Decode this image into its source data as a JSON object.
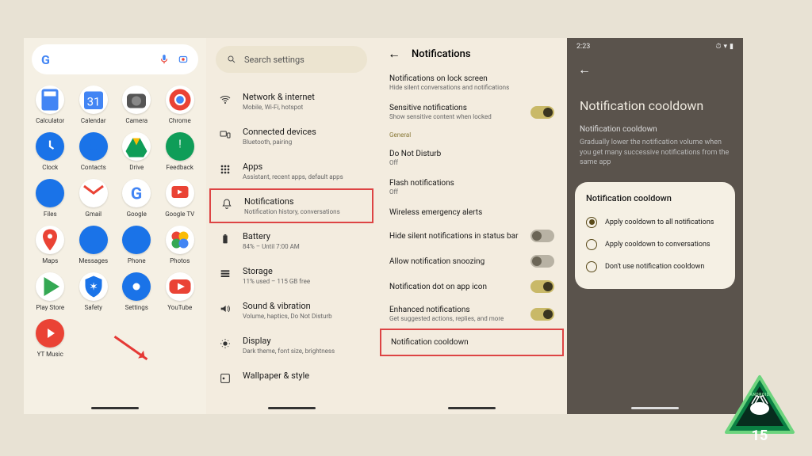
{
  "panel1": {
    "apps": [
      {
        "label": "Calculator",
        "icon": "calc"
      },
      {
        "label": "Calendar",
        "icon": "cal"
      },
      {
        "label": "Camera",
        "icon": "cam"
      },
      {
        "label": "Chrome",
        "icon": "chrome"
      },
      {
        "label": "Clock",
        "icon": "clock"
      },
      {
        "label": "Contacts",
        "icon": "contacts"
      },
      {
        "label": "Drive",
        "icon": "drive"
      },
      {
        "label": "Feedback",
        "icon": "feedback"
      },
      {
        "label": "Files",
        "icon": "files"
      },
      {
        "label": "Gmail",
        "icon": "gmail"
      },
      {
        "label": "Google",
        "icon": "google"
      },
      {
        "label": "Google TV",
        "icon": "gtv"
      },
      {
        "label": "Maps",
        "icon": "maps"
      },
      {
        "label": "Messages",
        "icon": "messages"
      },
      {
        "label": "Phone",
        "icon": "phone"
      },
      {
        "label": "Photos",
        "icon": "photos"
      },
      {
        "label": "Play Store",
        "icon": "play"
      },
      {
        "label": "Safety",
        "icon": "safety"
      },
      {
        "label": "Settings",
        "icon": "settings"
      },
      {
        "label": "YouTube",
        "icon": "youtube"
      },
      {
        "label": "YT Music",
        "icon": "ytmusic"
      }
    ]
  },
  "panel2": {
    "search_placeholder": "Search settings",
    "items": [
      {
        "title": "Network & internet",
        "subtitle": "Mobile, Wi-Fi, hotspot",
        "icon": "wifi"
      },
      {
        "title": "Connected devices",
        "subtitle": "Bluetooth, pairing",
        "icon": "devices"
      },
      {
        "title": "Apps",
        "subtitle": "Assistant, recent apps, default apps",
        "icon": "apps"
      },
      {
        "title": "Notifications",
        "subtitle": "Notification history, conversations",
        "icon": "bell",
        "highlight": true
      },
      {
        "title": "Battery",
        "subtitle": "84% – Until 7:00 AM",
        "icon": "battery"
      },
      {
        "title": "Storage",
        "subtitle": "11% used – 115 GB free",
        "icon": "storage"
      },
      {
        "title": "Sound & vibration",
        "subtitle": "Volume, haptics, Do Not Disturb",
        "icon": "sound"
      },
      {
        "title": "Display",
        "subtitle": "Dark theme, font size, brightness",
        "icon": "display"
      },
      {
        "title": "Wallpaper & style",
        "subtitle": "",
        "icon": "wallpaper"
      }
    ]
  },
  "panel3": {
    "title": "Notifications",
    "items": [
      {
        "title": "Notifications on lock screen",
        "subtitle": "Hide silent conversations and notifications"
      },
      {
        "title": "Sensitive notifications",
        "subtitle": "Show sensitive content when locked",
        "toggle": "on"
      },
      {
        "section": "General"
      },
      {
        "title": "Do Not Disturb",
        "subtitle": "Off"
      },
      {
        "title": "Flash notifications",
        "subtitle": "Off"
      },
      {
        "title": "Wireless emergency alerts"
      },
      {
        "title": "Hide silent notifications in status bar",
        "toggle": "off"
      },
      {
        "title": "Allow notification snoozing",
        "toggle": "off"
      },
      {
        "title": "Notification dot on app icon",
        "toggle": "on"
      },
      {
        "title": "Enhanced notifications",
        "subtitle": "Get suggested actions, replies, and more",
        "toggle": "on"
      },
      {
        "title": "Notification cooldown",
        "highlight": true
      }
    ]
  },
  "panel4": {
    "time": "2:23",
    "title": "Notification cooldown",
    "sub_title": "Notification cooldown",
    "sub_desc": "Gradually lower the notification volume when you get many successive notifications from the same app",
    "card_title": "Notification cooldown",
    "options": [
      {
        "label": "Apply cooldown to all notifications",
        "selected": true
      },
      {
        "label": "Apply cooldown to conversations",
        "selected": false
      },
      {
        "label": "Don't use notification cooldown",
        "selected": false
      }
    ]
  },
  "badge": {
    "top": "ANDROID",
    "num": "15"
  }
}
